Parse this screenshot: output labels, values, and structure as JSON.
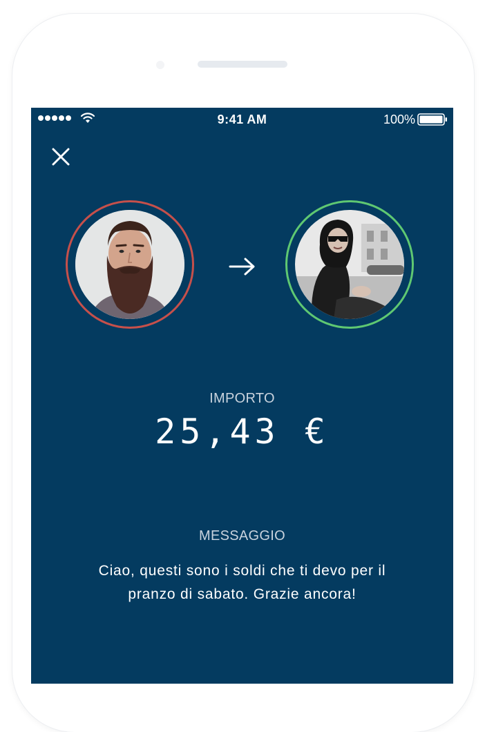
{
  "status_bar": {
    "time": "9:41 AM",
    "battery": "100%"
  },
  "icons": {
    "close": "close-icon",
    "arrow": "arrow-right-icon",
    "signal": "signal-dots-icon",
    "wifi": "wifi-icon",
    "battery": "battery-icon"
  },
  "transfer": {
    "sender_avatar": "bearded-man-photo",
    "recipient_avatar": "woman-sunglasses-photo",
    "amount_label": "IMPORTO",
    "amount": "25,43 €",
    "message_label": "MESSAGGIO",
    "message": "Ciao, questi sono i soldi che ti devo per il pranzo di sabato. Grazie ancora!"
  },
  "colors": {
    "background": "#043b60",
    "sender_ring": "#c6504b",
    "recipient_ring": "#5fc872",
    "label": "#c9d3de",
    "text": "#ffffff"
  }
}
